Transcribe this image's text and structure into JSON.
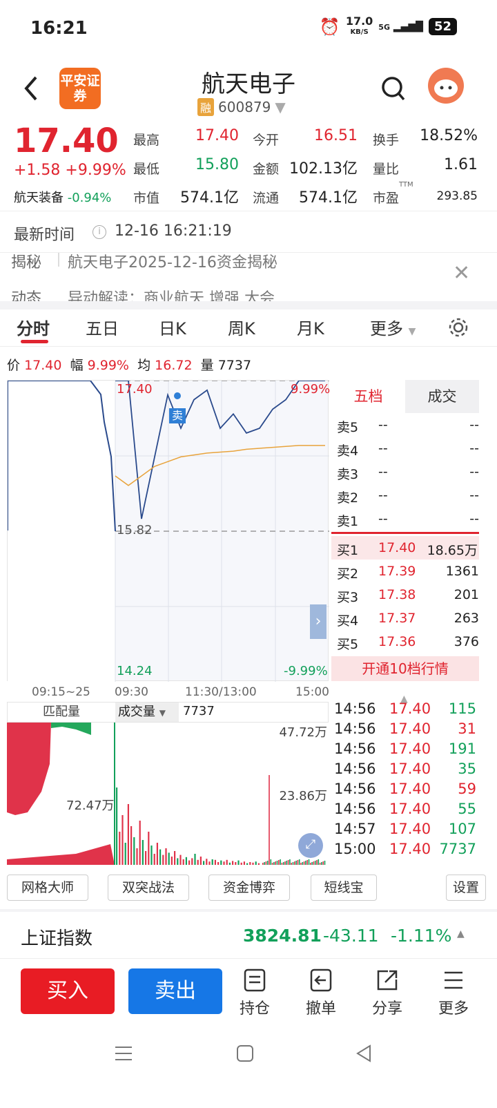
{
  "status_bar": {
    "time": "16:21",
    "net_speed": "17.0",
    "net_unit": "KB/S",
    "signal": "5G",
    "battery": "52"
  },
  "header": {
    "title": "航天电子",
    "broker_logo_text": "平安证券",
    "margin_tag": "融",
    "code": "600879"
  },
  "quote": {
    "price": "17.40",
    "change": "+1.58",
    "change_pct": "+9.99%",
    "sector_name": "航天装备",
    "sector_change": "-0.94%",
    "fields": [
      {
        "label": "最高",
        "value": "17.40"
      },
      {
        "label": "今开",
        "value": "16.51"
      },
      {
        "label": "换手",
        "value": "18.52%"
      },
      {
        "label": "最低",
        "value": "15.80"
      },
      {
        "label": "金额",
        "value": "102.13亿"
      },
      {
        "label": "量比",
        "value": "1.61"
      },
      {
        "label": "市值",
        "value": "574.1亿"
      },
      {
        "label": "流通",
        "value": "574.1亿"
      },
      {
        "label": "市盈",
        "value": "293.85"
      }
    ],
    "pe_suffix": "TTM"
  },
  "latest_time": {
    "label": "最新时间",
    "value": "12-16 16:21:19"
  },
  "news": {
    "tag": "揭秘",
    "text": "航天电子2025-12-16资金揭秘",
    "tag2": "动态",
    "text2": "异动解读：商业航天 增强 大会"
  },
  "tabs": [
    "分时",
    "五日",
    "日K",
    "周K",
    "月K",
    "更多"
  ],
  "info_line": {
    "price_label": "价",
    "price": "17.40",
    "amp_label": "幅",
    "amp": "9.99%",
    "avg_label": "均",
    "avg": "16.72",
    "vol_label": "量",
    "vol": "7737"
  },
  "chart_labels": {
    "high": "17.40",
    "high_pct": "9.99%",
    "mid": "15.82",
    "low": "14.24",
    "low_pct": "-9.99%",
    "sell_marker": "卖"
  },
  "time_axis": [
    "09:15~25",
    "09:30",
    "11:30/13:00",
    "15:00"
  ],
  "volume_header": {
    "left_label": "匹配量",
    "select_label": "成交量",
    "value": "7737",
    "max": "47.72万",
    "half": "23.86万",
    "auction": "72.47万"
  },
  "orderbook": {
    "tabs": [
      "五档",
      "成交"
    ],
    "asks": [
      {
        "label": "卖5",
        "price": "--",
        "vol": "--"
      },
      {
        "label": "卖4",
        "price": "--",
        "vol": "--"
      },
      {
        "label": "卖3",
        "price": "--",
        "vol": "--"
      },
      {
        "label": "卖2",
        "price": "--",
        "vol": "--"
      },
      {
        "label": "卖1",
        "price": "--",
        "vol": "--"
      }
    ],
    "bids": [
      {
        "label": "买1",
        "price": "17.40",
        "vol": "18.65万"
      },
      {
        "label": "买2",
        "price": "17.39",
        "vol": "1361"
      },
      {
        "label": "买3",
        "price": "17.38",
        "vol": "201"
      },
      {
        "label": "买4",
        "price": "17.37",
        "vol": "263"
      },
      {
        "label": "买5",
        "price": "17.36",
        "vol": "376"
      }
    ],
    "promo": "开通10档行情"
  },
  "trades": [
    {
      "time": "14:56",
      "price": "17.40",
      "vol": "115"
    },
    {
      "time": "14:56",
      "price": "17.40",
      "vol": "31"
    },
    {
      "time": "14:56",
      "price": "17.40",
      "vol": "191"
    },
    {
      "time": "14:56",
      "price": "17.40",
      "vol": "35"
    },
    {
      "time": "14:56",
      "price": "17.40",
      "vol": "59"
    },
    {
      "time": "14:56",
      "price": "17.40",
      "vol": "55"
    },
    {
      "time": "14:57",
      "price": "17.40",
      "vol": "107"
    },
    {
      "time": "15:00",
      "price": "17.40",
      "vol": "7737"
    }
  ],
  "tools": [
    "网格大师",
    "双突战法",
    "资金博弈",
    "短线宝",
    "设置"
  ],
  "index": {
    "name": "上证指数",
    "value": "3824.81",
    "change": "-43.11",
    "pct": "-1.11%"
  },
  "bottom_bar": {
    "buy": "买入",
    "sell": "卖出",
    "items": [
      "持仓",
      "撤单",
      "分享",
      "更多"
    ]
  },
  "colors": {
    "up": "#e0242f",
    "down": "#12a05a",
    "buy_button": "#e81c24",
    "sell_button": "#1677e6",
    "price_line": "#2a4a8c",
    "avg_line": "#e8a33b"
  },
  "chart_data": {
    "type": "line",
    "title": "",
    "xlabel": "",
    "ylabel": "",
    "x": [
      "09:15~25",
      "09:30",
      "11:30/13:00",
      "15:00"
    ],
    "ylim": [
      14.24,
      17.4
    ],
    "reference_price": 15.82,
    "series": [
      {
        "values": [
          17.4,
          17.4,
          15.95,
          16.6,
          17.25,
          16.9,
          17.2,
          17.3,
          16.9,
          17.05,
          16.85,
          16.9,
          17.1,
          17.2,
          17.4,
          17.4,
          17.4
        ]
      },
      {
        "values": [
          16.4,
          16.3,
          16.4,
          16.5,
          16.55,
          16.6,
          16.62,
          16.64,
          16.65,
          16.66,
          16.68,
          16.69,
          16.7,
          16.71,
          16.72,
          16.72,
          16.72
        ]
      }
    ]
  }
}
